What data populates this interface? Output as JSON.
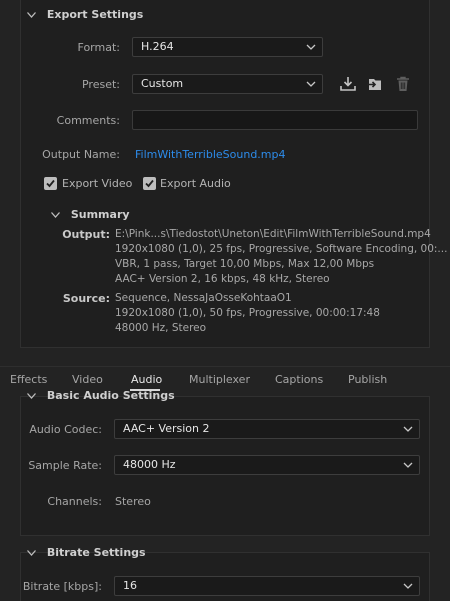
{
  "export_settings": {
    "title": "Export Settings",
    "format_label": "Format:",
    "format_value": "H.264",
    "preset_label": "Preset:",
    "preset_value": "Custom",
    "comments_label": "Comments:",
    "comments_value": "",
    "output_name_label": "Output Name:",
    "output_name_value": "FilmWithTerribleSound.mp4",
    "export_video_label": "Export Video",
    "export_video_checked": true,
    "export_audio_label": "Export Audio",
    "export_audio_checked": true
  },
  "summary": {
    "title": "Summary",
    "output_label": "Output:",
    "output_lines": [
      "E:\\Pink...s\\Tiedostot\\Uneton\\Edit\\FilmWithTerribleSound.mp4",
      "1920x1080 (1,0), 25 fps, Progressive, Software Encoding, 00:...",
      "VBR, 1 pass, Target 10,00 Mbps, Max 12,00 Mbps",
      "AAC+ Version 2, 16 kbps, 48 kHz, Stereo"
    ],
    "source_label": "Source:",
    "source_lines": [
      "Sequence, NessaJaOsseKohtaaO1",
      "1920x1080 (1,0), 50 fps, Progressive, 00:00:17:48",
      "48000 Hz, Stereo"
    ]
  },
  "tabs": [
    "Effects",
    "Video",
    "Audio",
    "Multiplexer",
    "Captions",
    "Publish"
  ],
  "active_tab": "Audio",
  "basic_audio": {
    "title": "Basic Audio Settings",
    "codec_label": "Audio Codec:",
    "codec_value": "AAC+ Version 2",
    "sample_rate_label": "Sample Rate:",
    "sample_rate_value": "48000 Hz",
    "channels_label": "Channels:",
    "channels_value": "Stereo"
  },
  "bitrate": {
    "title": "Bitrate Settings",
    "bitrate_label": "Bitrate [kbps]:",
    "bitrate_value": "16"
  },
  "icons": {
    "save_preset": "save-preset-icon",
    "import_preset": "import-preset-icon",
    "delete_preset": "trash-icon"
  },
  "colors": {
    "background": "#232323",
    "panel": "#1f1f1f",
    "link": "#2d8ceb",
    "text": "#b4b4b4"
  }
}
